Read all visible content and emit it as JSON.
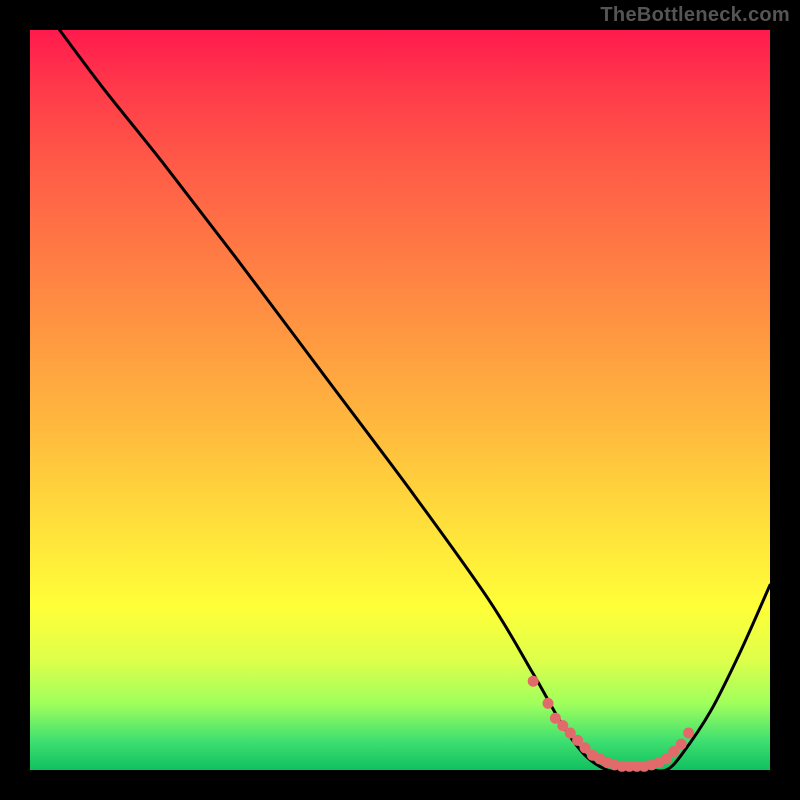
{
  "watermark": "TheBottleneck.com",
  "colors": {
    "background": "#000000",
    "gradient_top": "#ff1a4d",
    "gradient_mid1": "#ff9a41",
    "gradient_mid2": "#ffff38",
    "gradient_bottom": "#10c060",
    "curve": "#000000",
    "marker": "#e36a6a"
  },
  "chart_data": {
    "type": "line",
    "title": "",
    "xlabel": "",
    "ylabel": "",
    "xlim": [
      0,
      100
    ],
    "ylim": [
      0,
      100
    ],
    "grid": false,
    "series": [
      {
        "name": "bottleneck-curve",
        "x": [
          4,
          10,
          18,
          28,
          40,
          52,
          62,
          68,
          72,
          75,
          78,
          80,
          82,
          84,
          86,
          88,
          92,
          96,
          100
        ],
        "y": [
          100,
          92,
          82,
          69,
          53,
          37,
          23,
          13,
          6,
          2,
          0,
          0,
          0,
          0,
          0,
          2,
          8,
          16,
          25
        ]
      }
    ],
    "markers": [
      {
        "name": "highlight-dots",
        "x": [
          68,
          70,
          71,
          72,
          73,
          74,
          75,
          76,
          77,
          78,
          79,
          80,
          81,
          82,
          83,
          84,
          85,
          86,
          87,
          88,
          89
        ],
        "y": [
          12,
          9,
          7,
          6,
          5,
          4,
          3,
          2,
          1.5,
          1,
          0.7,
          0.5,
          0.5,
          0.5,
          0.5,
          0.7,
          1,
          1.5,
          2.5,
          3.5,
          5
        ]
      }
    ]
  }
}
